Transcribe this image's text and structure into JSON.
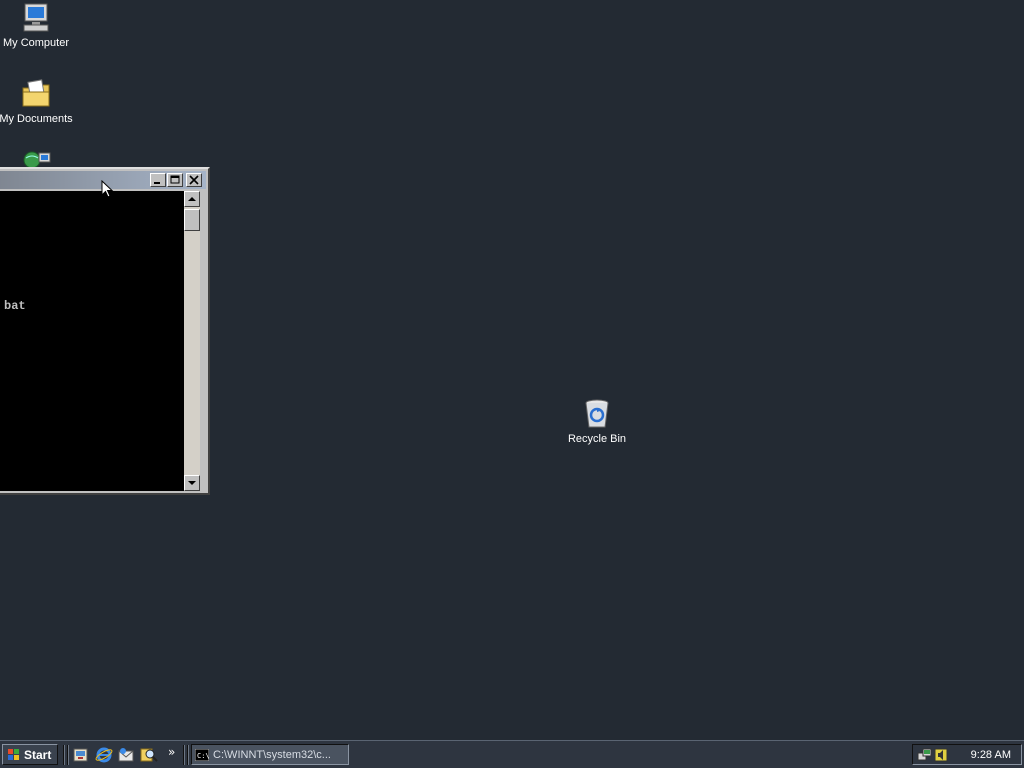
{
  "desktop": {
    "icons": [
      {
        "label": "My Computer"
      },
      {
        "label": "My Documents"
      },
      {
        "label": "Recycle Bin"
      }
    ]
  },
  "console_window": {
    "visible_text": "bat"
  },
  "taskbar": {
    "start_label": "Start",
    "quick_launch": [
      "show-desktop-icon",
      "internet-explorer-icon",
      "outlook-express-icon",
      "search-icon"
    ],
    "chevron": "»",
    "task_button_label": "C:\\WINNT\\system32\\c...",
    "clock": "9:28 AM"
  }
}
